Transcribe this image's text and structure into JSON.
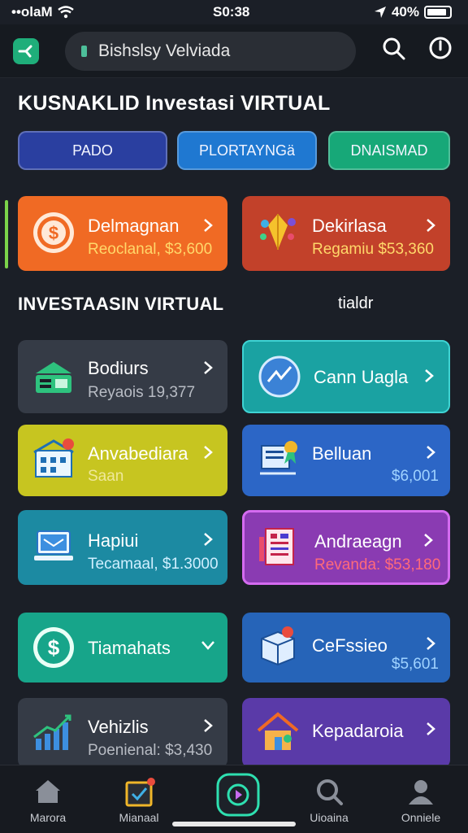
{
  "status_bar": {
    "carrier": "••olaM",
    "time": "S0:38",
    "battery": "40%",
    "battery_level": 0.9
  },
  "header": {
    "search_text": "Bishslsy Velviada"
  },
  "section1": {
    "title": "KUSNAKLID  Investasi VIRTUAL"
  },
  "tabs": [
    {
      "label": "PADO",
      "color": "#2a3fa0"
    },
    {
      "label": "PLORTAYNGä",
      "color": "#1f78d1"
    },
    {
      "label": "DNAISMAD",
      "color": "#17a878"
    }
  ],
  "featured": [
    {
      "title": "Delmagnan",
      "subtitle": "Reoclanal, $3,600",
      "icon": "dollar-coin-icon",
      "color": "#f06a24"
    },
    {
      "title": "Dekirlasa",
      "subtitle": "Regamiu $53,360",
      "icon": "gem-pen-icon",
      "color": "#c2412a"
    }
  ],
  "section2": {
    "title": "INVESTAASIN VIRTUAL",
    "side_label": "tialdr"
  },
  "cards": [
    {
      "title": "Bodiurs",
      "subtitle": "Reyaois 19,377",
      "icon": "cash-stack-icon",
      "color": "#353b46",
      "sub_color": "#b8bcc4"
    },
    {
      "title": "Cann Uagla",
      "subtitle": "",
      "icon": "globe-icon",
      "color": "#1aa2a2",
      "sub_color": "#ffffff"
    },
    {
      "title": "Anvabediara",
      "subtitle": "Saan",
      "icon": "building-icon",
      "color": "#c7c520",
      "sub_color": "#efe89a"
    },
    {
      "title": "Belluan",
      "subtitle": "$6,001",
      "icon": "certificate-icon",
      "color": "#2c66c6",
      "sub_color": "#9fd2ff"
    },
    {
      "title": "Hapiui",
      "subtitle": "Tecamaal, $1.3000",
      "icon": "laptop-icon",
      "color": "#1c8aa2",
      "sub_color": "#cfefff"
    },
    {
      "title": "Andraeagn",
      "subtitle": "Revanda: $53,180",
      "icon": "document-icon",
      "color": "#8a3bb2",
      "sub_color": "#ff6a7a"
    },
    {
      "title": "Tiamahats",
      "subtitle": "",
      "icon": "dollar-circle-icon",
      "color": "#17a58a",
      "sub_color": "#ffffff"
    },
    {
      "title": "CeFssieo",
      "subtitle": "$5,601",
      "icon": "box-icon",
      "color": "#2664b8",
      "sub_color": "#9fd2ff"
    },
    {
      "title": "Vehizlis",
      "subtitle": "Poenienal: $3,430",
      "icon": "growth-chart-icon",
      "color": "#353b46",
      "sub_color": "#b8bcc4"
    },
    {
      "title": "Kepadaroia",
      "subtitle": "",
      "icon": "house-icon",
      "color": "#5a3aa8",
      "sub_color": "#ffffff"
    }
  ],
  "nav": [
    {
      "label": "Marora",
      "icon": "home-icon"
    },
    {
      "label": "Mianaal",
      "icon": "calendar-icon"
    },
    {
      "label": "",
      "icon": "play-center-icon"
    },
    {
      "label": "Uioaina",
      "icon": "search-icon"
    },
    {
      "label": "Onniele",
      "icon": "profile-icon"
    }
  ]
}
